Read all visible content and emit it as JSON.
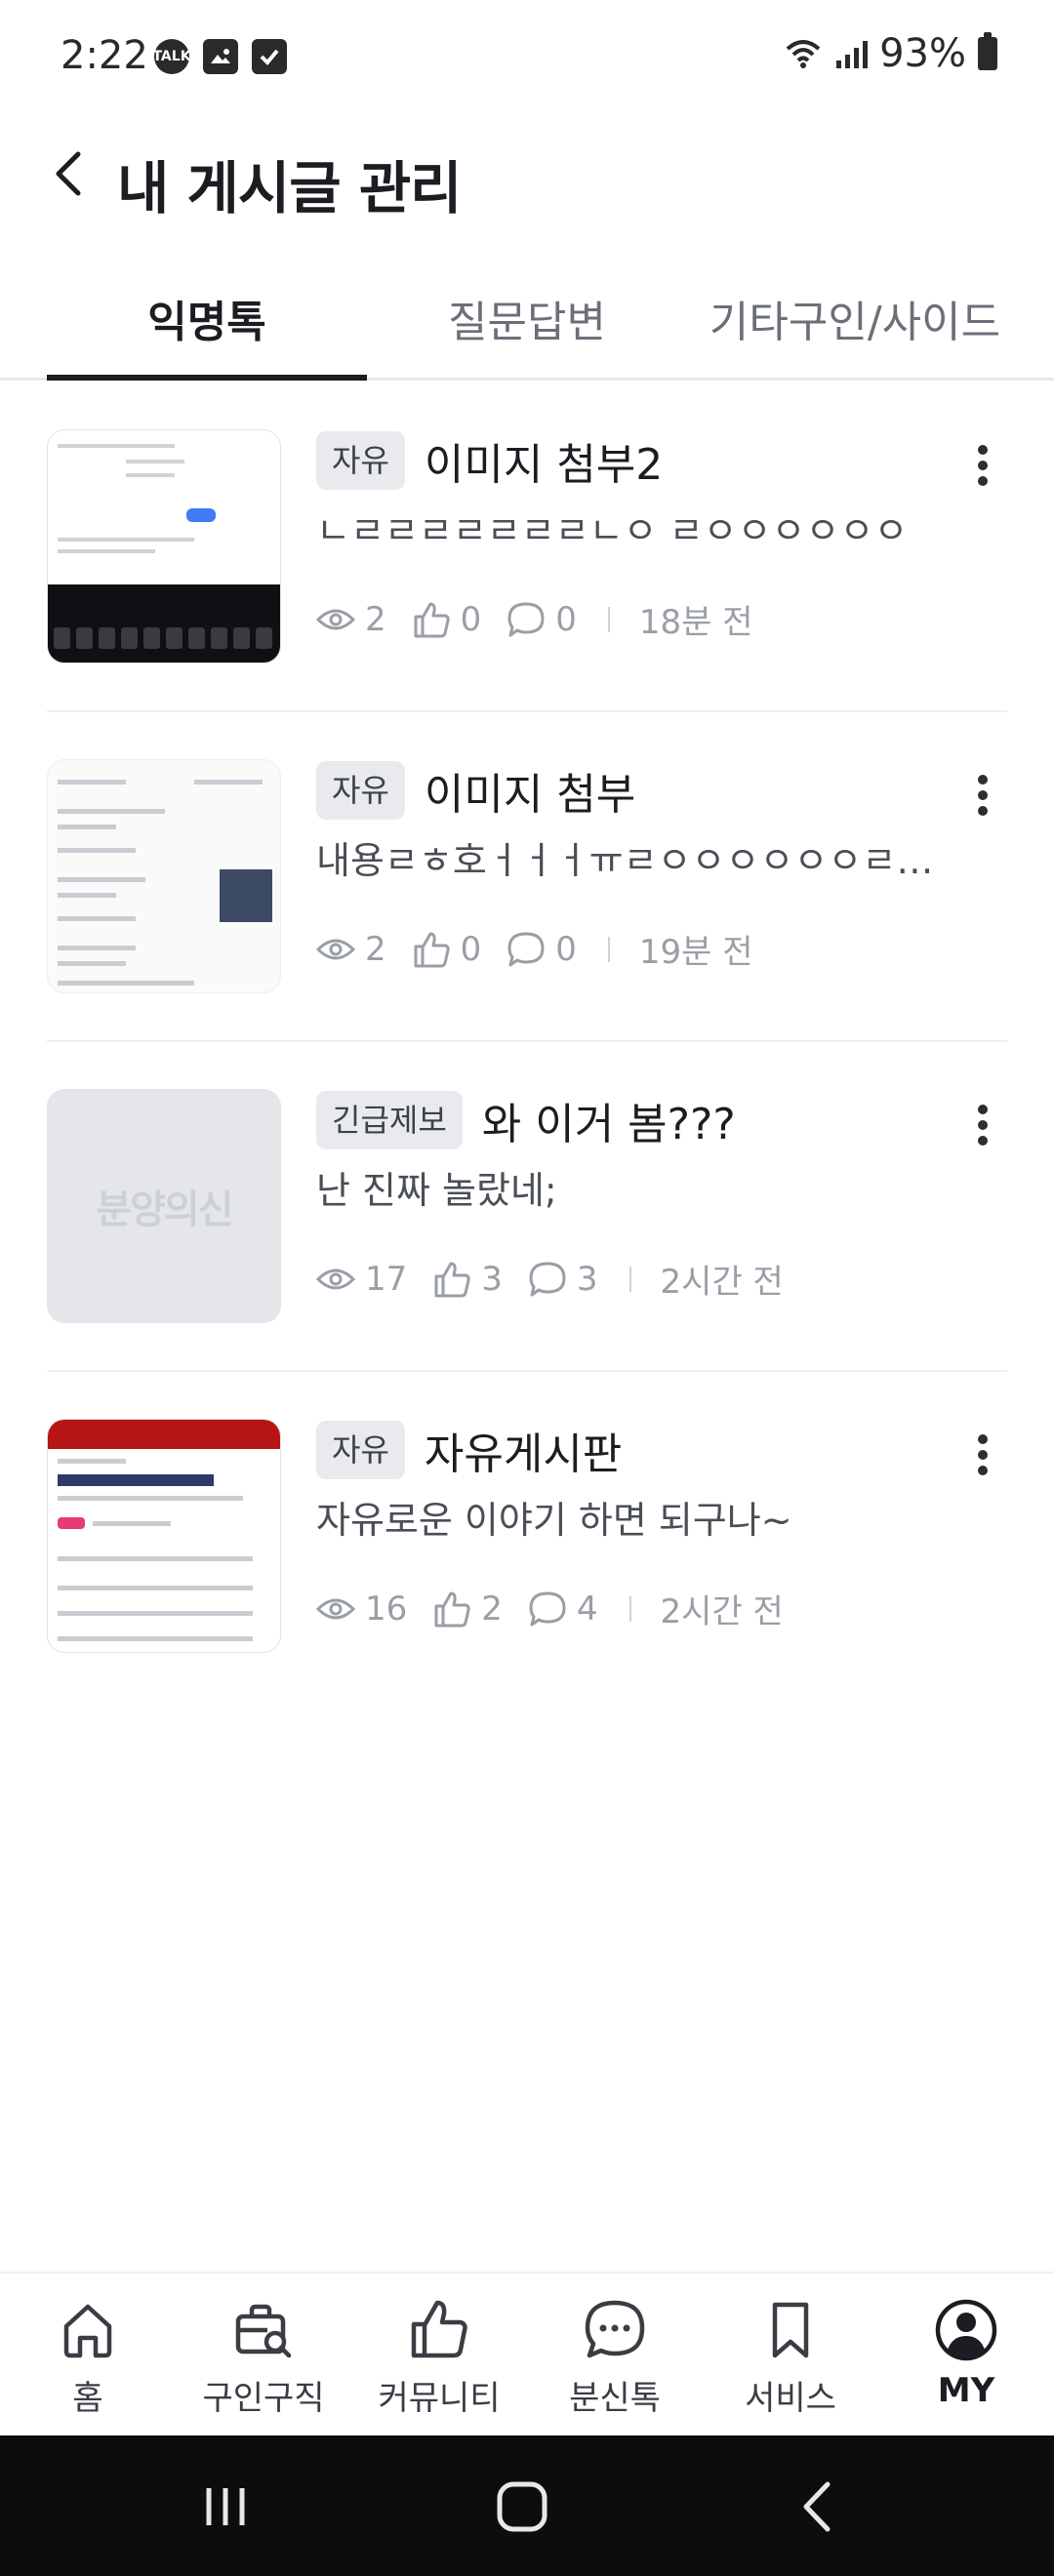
{
  "status_bar": {
    "time": "2:22",
    "battery": "93%",
    "icons": [
      "talk-icon",
      "image-icon",
      "checkbox-icon",
      "wifi-icon",
      "signal-icon",
      "battery-icon"
    ],
    "talk_label": "TALK"
  },
  "header": {
    "title": "내 게시글 관리"
  },
  "tabs": [
    {
      "label": "익명톡",
      "active": true
    },
    {
      "label": "질문답변",
      "active": false
    },
    {
      "label": "기타구인/사이드",
      "active": false
    }
  ],
  "posts": [
    {
      "badge": "자유",
      "title": "이미지 첨부2",
      "excerpt": "ㄴㄹㄹㄹㄹㄹㄹㄹㄴㅇ ㄹㅇㅇㅇㅇㅇㅇ",
      "views": "2",
      "likes": "0",
      "comments": "0",
      "time": "18분 전"
    },
    {
      "badge": "자유",
      "title": "이미지 첨부",
      "excerpt": "내용ㄹㅎ호ㅓㅓㅓㅠㄹㅇㅇㅇㅇㅇㅇㄹㄴ...",
      "views": "2",
      "likes": "0",
      "comments": "0",
      "time": "19분 전"
    },
    {
      "badge": "긴급제보",
      "title": "와 이거 봄???",
      "excerpt": "난 진짜 놀랐네;",
      "views": "17",
      "likes": "3",
      "comments": "3",
      "time": "2시간 전",
      "thumb_logo": "분양의신"
    },
    {
      "badge": "자유",
      "title": "자유게시판",
      "excerpt": "자유로운 이야기 하면 되구나~",
      "views": "16",
      "likes": "2",
      "comments": "4",
      "time": "2시간 전"
    }
  ],
  "bottom_nav": [
    {
      "label": "홈",
      "icon": "home-icon"
    },
    {
      "label": "구인구직",
      "icon": "briefcase-search-icon"
    },
    {
      "label": "커뮤니티",
      "icon": "thumbs-up-icon"
    },
    {
      "label": "분신톡",
      "icon": "chat-bubble-icon"
    },
    {
      "label": "서비스",
      "icon": "bookmark-icon"
    },
    {
      "label": "MY",
      "icon": "profile-icon",
      "active": true
    }
  ],
  "colors": {
    "text_primary": "#1b1d22",
    "text_secondary": "#4a4e56",
    "meta": "#9a9ea6",
    "badge_bg": "#e9eaee",
    "system_nav": "#0d0d0f"
  }
}
